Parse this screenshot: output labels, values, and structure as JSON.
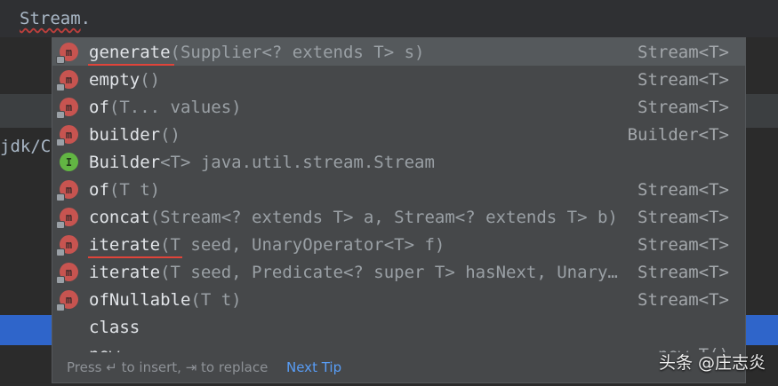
{
  "editor": {
    "prefix": "Stream",
    "dot": ".",
    "background_fragment": "jdk/Co"
  },
  "completion": {
    "items": [
      {
        "icon": "method-icon",
        "name": "generate",
        "params": "(Supplier<? extends T> s)",
        "rtype": "Stream<T>"
      },
      {
        "icon": "method-icon",
        "name": "empty",
        "params": "()",
        "rtype": "Stream<T>"
      },
      {
        "icon": "method-icon",
        "name": "of",
        "params": "(T... values)",
        "rtype": "Stream<T>"
      },
      {
        "icon": "method-icon",
        "name": "builder",
        "params": "()",
        "rtype": "Builder<T>"
      },
      {
        "icon": "interface-icon",
        "name": "Builder",
        "params": "<T> java.util.stream.Stream",
        "rtype": ""
      },
      {
        "icon": "method-icon",
        "name": "of",
        "params": "(T t)",
        "rtype": "Stream<T>"
      },
      {
        "icon": "method-icon",
        "name": "concat",
        "params": "(Stream<? extends T> a, Stream<? extends T> b)",
        "rtype": "Stream<T>"
      },
      {
        "icon": "method-icon",
        "name": "iterate",
        "params": "(T seed, UnaryOperator<T> f)",
        "rtype": "Stream<T>"
      },
      {
        "icon": "method-icon",
        "name": "iterate",
        "params": "(T seed, Predicate<? super T> hasNext, Unary…",
        "rtype": "Stream<T>"
      },
      {
        "icon": "method-icon",
        "name": "ofNullable",
        "params": "(T t)",
        "rtype": "Stream<T>"
      },
      {
        "icon": "",
        "name": "class",
        "params": "",
        "rtype": ""
      },
      {
        "icon": "",
        "name": "new",
        "params": "",
        "rtype": "new T()"
      }
    ],
    "badge_m": "m",
    "badge_i": "I",
    "footer": {
      "hint": "Press ↵ to insert, ⇥ to replace",
      "next_tip": "Next Tip"
    }
  },
  "watermark": "头条 @庄志炎",
  "colors": {
    "popup_bg": "#46484a",
    "selection": "#55595c",
    "method_badge": "#c75450",
    "interface_badge": "#62b543",
    "link": "#589df6",
    "annotation_underline": "#e0443a"
  }
}
